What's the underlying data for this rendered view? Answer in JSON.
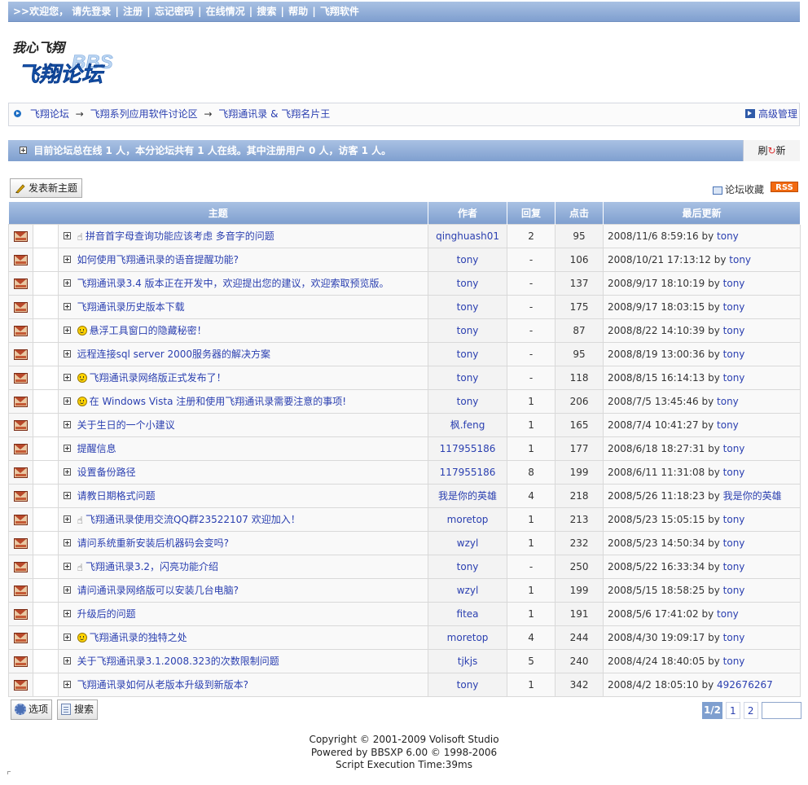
{
  "topbar": {
    "prefix": ">>欢迎您， 请先登录",
    "links": [
      "注册",
      "忘记密码",
      "在线情况",
      "搜索",
      "帮助",
      "飞翔软件"
    ]
  },
  "logo": {
    "script_text": "我心飞翔",
    "main_text": "飞翔论坛",
    "bbs_text": "BBS"
  },
  "breadcrumb": {
    "items": [
      "飞翔论坛",
      "飞翔系列应用软件讨论区",
      "飞翔通讯录 & 飞翔名片王"
    ],
    "arrow": "→",
    "admin_label": "高级管理"
  },
  "status": {
    "text": "目前论坛总在线 1 人，本分论坛共有 1 人在线。其中注册用户 0 人，访客 1 人。",
    "refresh_label_a": "刷",
    "refresh_label_b": "新"
  },
  "toolbar": {
    "new_topic_label": "发表新主题",
    "favorite_label": "论坛收藏",
    "rss_label": "RSS"
  },
  "table": {
    "headers": {
      "topic": "主题",
      "author": "作者",
      "replies": "回复",
      "clicks": "点击",
      "last": "最后更新"
    },
    "by": "by",
    "rows": [
      {
        "mood": "hand",
        "title": "拼音首字母查询功能应该考虑 多音字的问题",
        "author": "qinghuash01",
        "replies": "2",
        "clicks": "95",
        "time": "2008/11/6 8:59:16",
        "last_user": "tony"
      },
      {
        "mood": "",
        "title": "如何使用飞翔通讯录的语音提醒功能?",
        "author": "tony",
        "replies": "-",
        "clicks": "106",
        "time": "2008/10/21 17:13:12",
        "last_user": "tony"
      },
      {
        "mood": "",
        "title": "飞翔通讯录3.4 版本正在开发中，欢迎提出您的建议，欢迎索取预览版。",
        "author": "tony",
        "replies": "-",
        "clicks": "137",
        "time": "2008/9/17 18:10:19",
        "last_user": "tony"
      },
      {
        "mood": "",
        "title": "飞翔通讯录历史版本下载",
        "author": "tony",
        "replies": "-",
        "clicks": "175",
        "time": "2008/9/17 18:03:15",
        "last_user": "tony"
      },
      {
        "mood": "smile",
        "title": "悬浮工具窗口的隐藏秘密！",
        "author": "tony",
        "replies": "-",
        "clicks": "87",
        "time": "2008/8/22 14:10:39",
        "last_user": "tony"
      },
      {
        "mood": "",
        "title": "远程连接sql server 2000服务器的解决方案",
        "author": "tony",
        "replies": "-",
        "clicks": "95",
        "time": "2008/8/19 13:00:36",
        "last_user": "tony"
      },
      {
        "mood": "smile",
        "title": "飞翔通讯录网络版正式发布了！",
        "author": "tony",
        "replies": "-",
        "clicks": "118",
        "time": "2008/8/15 16:14:13",
        "last_user": "tony"
      },
      {
        "mood": "smile",
        "title": "在 Windows Vista 注册和使用飞翔通讯录需要注意的事项!",
        "author": "tony",
        "replies": "1",
        "clicks": "206",
        "time": "2008/7/5 13:45:46",
        "last_user": "tony"
      },
      {
        "mood": "",
        "title": "关于生日的一个小建议",
        "author": "枫.feng",
        "replies": "1",
        "clicks": "165",
        "time": "2008/7/4 10:41:27",
        "last_user": "tony"
      },
      {
        "mood": "",
        "title": "提醒信息",
        "author": "117955186",
        "replies": "1",
        "clicks": "177",
        "time": "2008/6/18 18:27:31",
        "last_user": "tony"
      },
      {
        "mood": "",
        "title": "设置备份路径",
        "author": "117955186",
        "replies": "8",
        "clicks": "199",
        "time": "2008/6/11 11:31:08",
        "last_user": "tony"
      },
      {
        "mood": "",
        "title": "请教日期格式问题",
        "author": "我是你的英雄",
        "replies": "4",
        "clicks": "218",
        "time": "2008/5/26 11:18:23",
        "last_user": "我是你的英雄"
      },
      {
        "mood": "hand",
        "title": "飞翔通讯录使用交流QQ群23522107 欢迎加入！",
        "author": "moretop",
        "replies": "1",
        "clicks": "213",
        "time": "2008/5/23 15:05:15",
        "last_user": "tony"
      },
      {
        "mood": "",
        "title": "请问系统重新安装后机器码会变吗?",
        "author": "wzyl",
        "replies": "1",
        "clicks": "232",
        "time": "2008/5/23 14:50:34",
        "last_user": "tony"
      },
      {
        "mood": "hand",
        "title": "飞翔通讯录3.2，闪亮功能介绍",
        "author": "tony",
        "replies": "-",
        "clicks": "250",
        "time": "2008/5/22 16:33:34",
        "last_user": "tony"
      },
      {
        "mood": "",
        "title": "请问通讯录网络版可以安装几台电脑?",
        "author": "wzyl",
        "replies": "1",
        "clicks": "199",
        "time": "2008/5/15 18:58:25",
        "last_user": "tony"
      },
      {
        "mood": "",
        "title": "升级后的问题",
        "author": "fitea",
        "replies": "1",
        "clicks": "191",
        "time": "2008/5/6 17:41:02",
        "last_user": "tony"
      },
      {
        "mood": "smile",
        "title": "飞翔通讯录的独特之处",
        "author": "moretop",
        "replies": "4",
        "clicks": "244",
        "time": "2008/4/30 19:09:17",
        "last_user": "tony"
      },
      {
        "mood": "",
        "title": "关于飞翔通讯录3.1.2008.323的次数限制问题",
        "author": "tjkjs",
        "replies": "5",
        "clicks": "240",
        "time": "2008/4/24 18:40:05",
        "last_user": "tony"
      },
      {
        "mood": "",
        "title": "飞翔通讯录如何从老版本升级到新版本?",
        "author": "tony",
        "replies": "1",
        "clicks": "342",
        "time": "2008/4/2 18:05:10",
        "last_user": "492676267"
      }
    ]
  },
  "bottom": {
    "options_label": "选项",
    "search_label": "搜索",
    "pager": {
      "current": "1/2",
      "pages": [
        "1",
        "2"
      ],
      "goto_value": ""
    }
  },
  "footer": {
    "line1": "Copyright © 2001-2009 Volisoft Studio",
    "line2": "Powered by BBSXP 6.00 © 1998-2006",
    "line3": "Script Execution Time:39ms"
  }
}
